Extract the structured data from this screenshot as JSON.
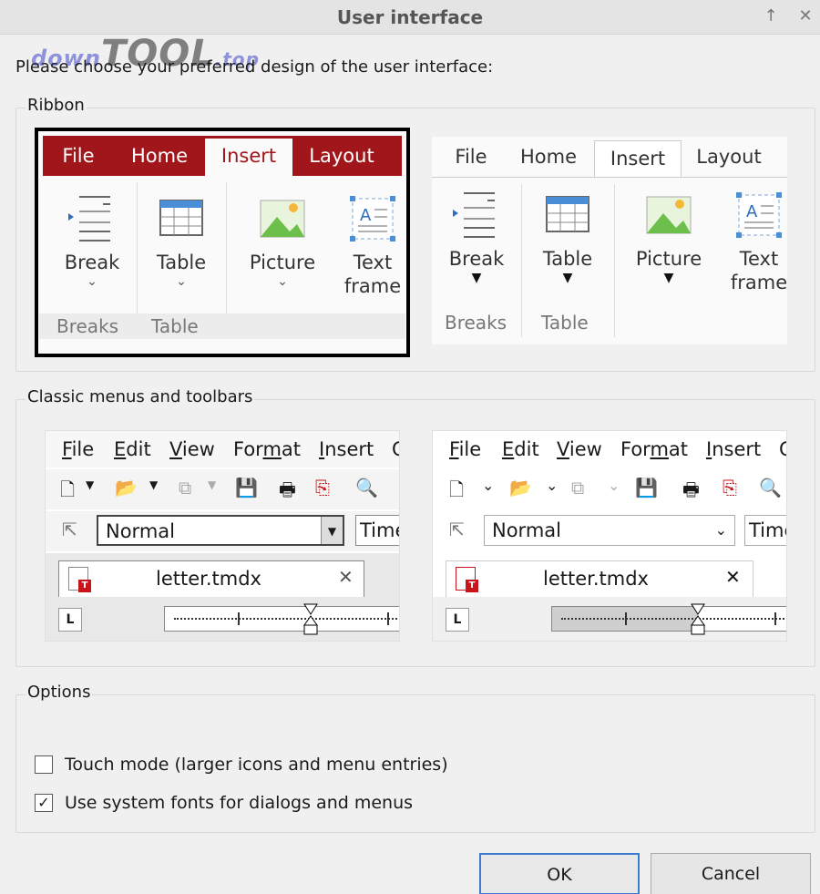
{
  "window": {
    "title": "User interface",
    "pin_icon": "pin-icon",
    "close_icon": "close-icon"
  },
  "watermark": {
    "part1": "down",
    "part2": "TOOL",
    "part3": ".top"
  },
  "intro": "Please choose your preferred design of the user interface:",
  "ribbon_group": {
    "label": "Ribbon",
    "tabs": [
      "File",
      "Home",
      "Insert",
      "Layout"
    ],
    "items": [
      {
        "label1": "Break",
        "label2": "",
        "icon": "page-break-icon"
      },
      {
        "label1": "Table",
        "label2": "",
        "icon": "table-icon"
      },
      {
        "label1": "Picture",
        "label2": "",
        "icon": "picture-icon"
      },
      {
        "label1": "Text",
        "label2": "frame",
        "icon": "text-frame-icon"
      }
    ],
    "group_labels": [
      "Breaks",
      "Table"
    ],
    "selected_option": "dark-ribbon"
  },
  "classic_group": {
    "label": "Classic menus and toolbars",
    "menus": [
      "File",
      "Edit",
      "View",
      "Format",
      "Insert",
      "C"
    ],
    "menu_underlines": [
      "F",
      "E",
      "V",
      "m",
      "I",
      ""
    ],
    "style_value": "Normal",
    "font_value": "Time",
    "doc_tab": "letter.tmdx",
    "ruler_corner": "L"
  },
  "options_group": {
    "label": "Options",
    "touch_mode": {
      "label": "Touch mode (larger icons and menu entries)",
      "checked": false
    },
    "system_fonts": {
      "label": "Use system fonts for dialogs and menus",
      "checked": true
    }
  },
  "buttons": {
    "ok": "OK",
    "cancel": "Cancel"
  },
  "colors": {
    "ribbon_red": "#a1161a",
    "ok_border": "#3d7bd0"
  }
}
